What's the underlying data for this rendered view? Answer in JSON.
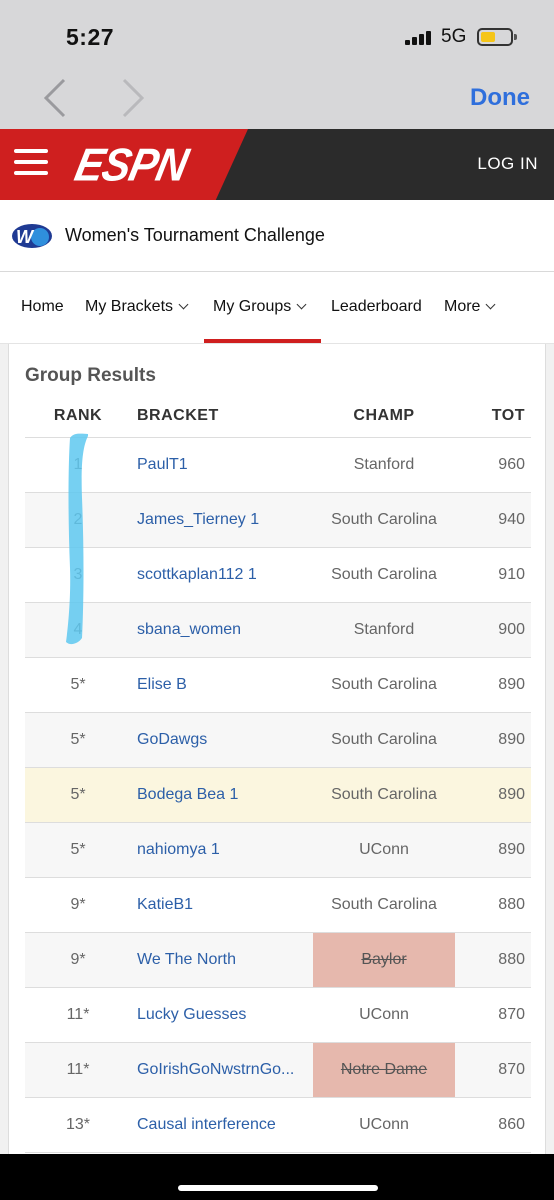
{
  "status": {
    "time": "5:27",
    "network": "5G"
  },
  "browser": {
    "done_label": "Done"
  },
  "espn": {
    "logo": "ESPN",
    "login_label": "LOG IN"
  },
  "game": {
    "title": "Women's Tournament Challenge"
  },
  "tabs": [
    {
      "label": "Home"
    },
    {
      "label": "My Brackets"
    },
    {
      "label": "My Groups"
    },
    {
      "label": "Leaderboard"
    },
    {
      "label": "More"
    }
  ],
  "group_results": {
    "title": "Group Results",
    "headers": {
      "rank": "RANK",
      "bracket": "BRACKET",
      "champ": "CHAMP",
      "tot": "TOT"
    },
    "rows": [
      {
        "rank": "1",
        "bracket": "PaulT1",
        "champ": "Stanford",
        "tot": "960"
      },
      {
        "rank": "2",
        "bracket": "James_Tierney 1",
        "champ": "South Carolina",
        "tot": "940"
      },
      {
        "rank": "3",
        "bracket": "scottkaplan112 1",
        "champ": "South Carolina",
        "tot": "910"
      },
      {
        "rank": "4",
        "bracket": "sbana_women",
        "champ": "Stanford",
        "tot": "900"
      },
      {
        "rank": "5*",
        "bracket": "Elise B",
        "champ": "South Carolina",
        "tot": "890"
      },
      {
        "rank": "5*",
        "bracket": "GoDawgs",
        "champ": "South Carolina",
        "tot": "890"
      },
      {
        "rank": "5*",
        "bracket": "Bodega Bea 1",
        "champ": "South Carolina",
        "tot": "890"
      },
      {
        "rank": "5*",
        "bracket": "nahiomya 1",
        "champ": "UConn",
        "tot": "890"
      },
      {
        "rank": "9*",
        "bracket": "KatieB1",
        "champ": "South Carolina",
        "tot": "880"
      },
      {
        "rank": "9*",
        "bracket": "We The North",
        "champ": "Baylor",
        "tot": "880"
      },
      {
        "rank": "11*",
        "bracket": "Lucky Guesses",
        "champ": "UConn",
        "tot": "870"
      },
      {
        "rank": "11*",
        "bracket": "GoIrishGoNwstrnGo...",
        "champ": "Notre Dame",
        "tot": "870"
      },
      {
        "rank": "13*",
        "bracket": "Causal interference",
        "champ": "UConn",
        "tot": "860"
      }
    ]
  },
  "colors": {
    "espn_red": "#cf1f1f",
    "link_blue": "#2c5fa8",
    "eliminated_bg": "#e6b8ad",
    "highlight_row": "#fbf6df",
    "marker_blue": "#5ec8f0"
  }
}
